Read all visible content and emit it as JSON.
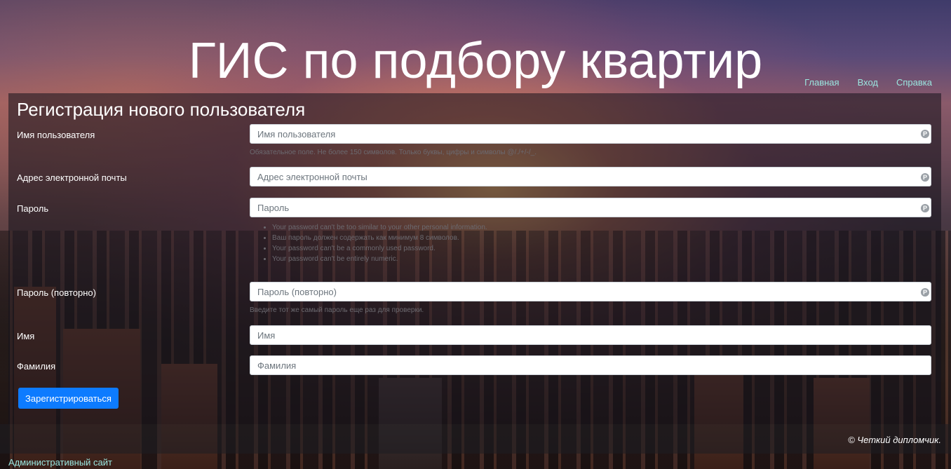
{
  "header": {
    "title": "ГИС по подбору квартир",
    "nav": [
      {
        "label": "Главная"
      },
      {
        "label": "Вход"
      },
      {
        "label": "Справка"
      }
    ]
  },
  "form": {
    "title": "Регистрация нового пользователя",
    "username": {
      "label": "Имя пользователя",
      "placeholder": "Имя пользователя",
      "help": "Обязательное поле. Не более 150 символов. Только буквы, цифры и символы @/./+/-/_."
    },
    "email": {
      "label": "Адрес электронной почты",
      "placeholder": "Адрес электронной почты"
    },
    "password": {
      "label": "Пароль",
      "placeholder": "Пароль",
      "rules": [
        "Your password can't be too similar to your other personal information.",
        "Ваш пароль должен содержать как минимум 8 символов.",
        "Your password can't be a commonly used password.",
        "Your password can't be entirely numeric."
      ]
    },
    "password2": {
      "label": "Пароль (повторно)",
      "placeholder": "Пароль (повторно)",
      "help": "Введите тот же самый пароль еще раз для проверки."
    },
    "first_name": {
      "label": "Имя",
      "placeholder": "Имя"
    },
    "last_name": {
      "label": "Фамилия",
      "placeholder": "Фамилия"
    },
    "submit_label": "Зарегистрироваться"
  },
  "footer": {
    "copyright": "© Четкий дипломчик.",
    "admin_link": "Административный сайт"
  },
  "colors": {
    "accent": "#0d7bff",
    "link": "#9be7e0"
  },
  "icons": {
    "password_manager": "password-manager-icon"
  }
}
